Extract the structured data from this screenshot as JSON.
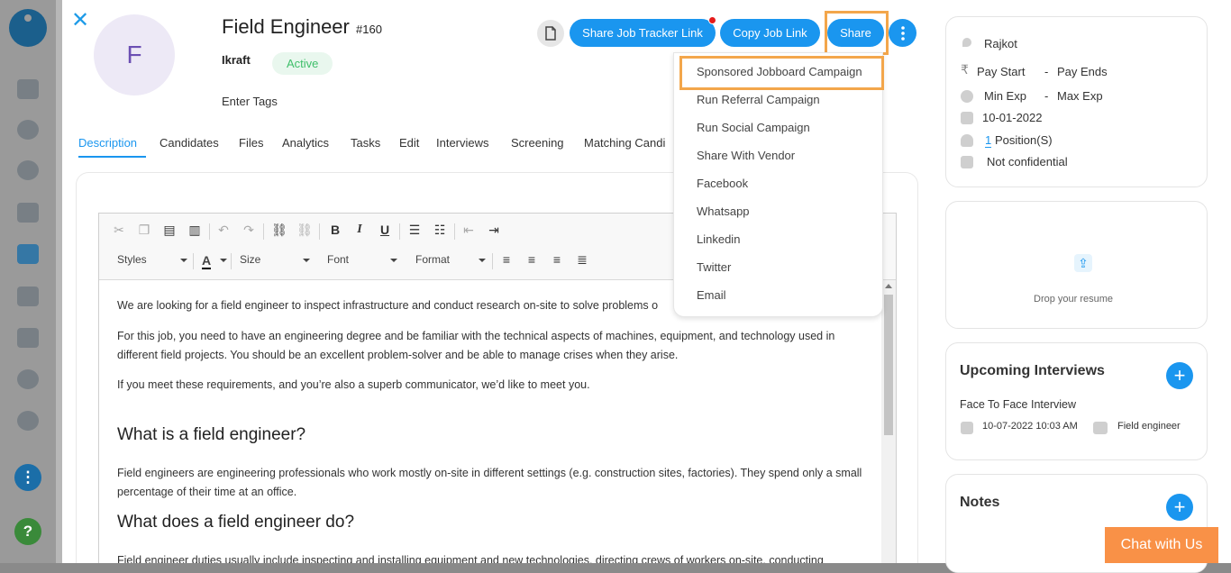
{
  "job": {
    "title": "Field Engineer",
    "number": "#160",
    "company": "Ikraft",
    "status": "Active",
    "tags_placeholder": "Enter Tags",
    "avatar_letter": "F"
  },
  "buttons": {
    "share_tracker": "Share Job Tracker Link",
    "copy_link": "Copy Job Link",
    "share": "Share"
  },
  "tabs": [
    "Description",
    "Candidates",
    "Files",
    "Analytics",
    "Tasks",
    "Edit",
    "Interviews",
    "Screening",
    "Matching Candi"
  ],
  "share_menu": [
    "Sponsored Jobboard Campaign",
    "Run Referral Campaign",
    "Run Social Campaign",
    "Share With Vendor",
    "Facebook",
    "Whatsapp",
    "Linkedin",
    "Twitter",
    "Email"
  ],
  "toolbar": {
    "styles": "Styles",
    "size": "Size",
    "font": "Font",
    "format": "Format",
    "text_color": "A"
  },
  "editor": {
    "p1": "We are looking for a field engineer to inspect infrastructure and conduct research on-site to solve problems o",
    "p2": "For this job, you need to have an engineering degree and be familiar with the technical aspects of machines, equipment, and technology used in different field projects. You should be an excellent problem-solver and be able to manage crises when they arise.",
    "p3": "If you meet these requirements, and you’re also a superb communicator, we’d like to meet you.",
    "h1": "What is a field engineer?",
    "p4": "Field engineers are engineering professionals who work mostly on-site in different settings (e.g. construction sites, factories). They spend only a small percentage of their time at an office.",
    "h2": "What does a field engineer do?",
    "p5": "Field engineer duties usually include inspecting and installing equipment and new technologies, directing crews of workers on-site, conducting"
  },
  "details": {
    "location": "Rajkot",
    "pay_start": "Pay Start",
    "pay_sep": "-",
    "pay_end": "Pay Ends",
    "min_exp": "Min Exp",
    "exp_sep": "-",
    "max_exp": "Max Exp",
    "date": "10-01-2022",
    "positions_count": "1",
    "positions_label": "Position(S)",
    "confidential": "Not confidential",
    "currency_symbol": "₹"
  },
  "resume": {
    "label": "Drop your resume"
  },
  "interviews": {
    "heading": "Upcoming Interviews",
    "type": "Face To Face Interview",
    "datetime": "10-07-2022 10:03 AM",
    "job": "Field engineer"
  },
  "notes": {
    "heading": "Notes"
  },
  "chat": {
    "label": "Chat with Us"
  },
  "colors": {
    "accent": "#1a96ef",
    "highlight": "#f3a64b",
    "active_green": "#3fbf6a",
    "chat": "#f99147"
  }
}
